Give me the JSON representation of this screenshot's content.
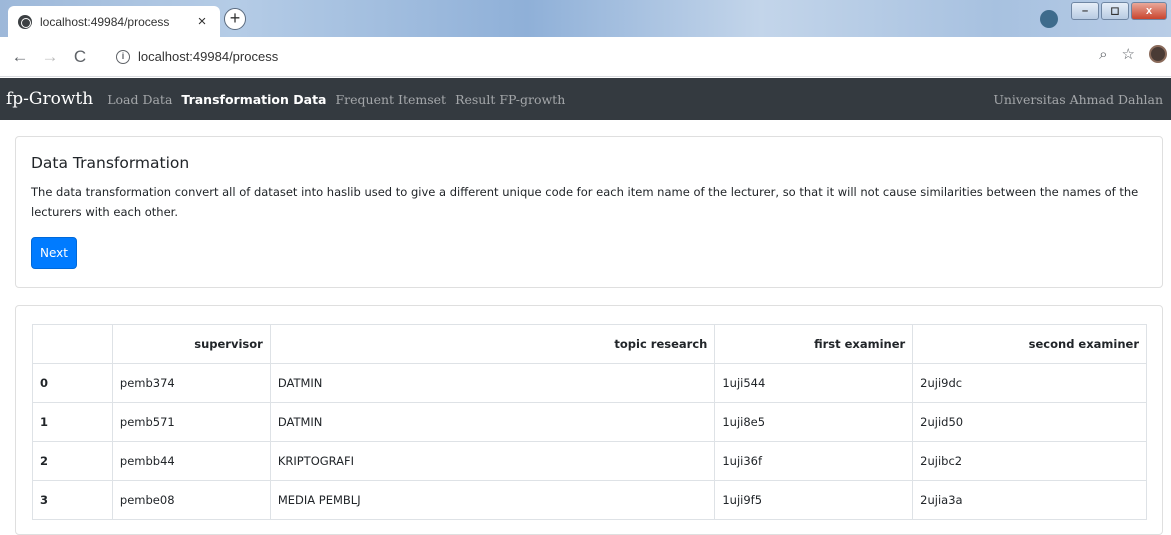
{
  "browser": {
    "tab_title": "localhost:49984/process",
    "tab_close": "×",
    "new_tab": "+",
    "url": "localhost:49984/process",
    "window_buttons": [
      "–",
      "◻",
      "x"
    ]
  },
  "navbar": {
    "brand": "fp-Growth",
    "links": [
      "Load Data",
      "Transformation Data",
      "Frequent Itemset",
      "Result FP-growth"
    ],
    "active_index": 1,
    "right_text": "Universitas Ahmad Dahlan"
  },
  "intro": {
    "title": "Data Transformation",
    "description": "The data transformation convert all of dataset into haslib used to give a different unique code for each item name of the lecturer, so that it will not cause similarities between the names of the lecturers with each other.",
    "next_button": "Next",
    "accent_color": "#007bff"
  },
  "table": {
    "columns": [
      "",
      "supervisor",
      "topic research",
      "first examiner",
      "second examiner"
    ],
    "rows": [
      [
        "0",
        "pemb374",
        "DATMIN",
        "1uji544",
        "2uji9dc"
      ],
      [
        "1",
        "pemb571",
        "DATMIN",
        "1uji8e5",
        "2ujid50"
      ],
      [
        "2",
        "pembb44",
        "KRIPTOGRAFI",
        "1uji36f",
        "2ujibc2"
      ],
      [
        "3",
        "pembe08",
        "MEDIA PEMBLJ",
        "1uji9f5",
        "2ujia3a"
      ]
    ]
  }
}
